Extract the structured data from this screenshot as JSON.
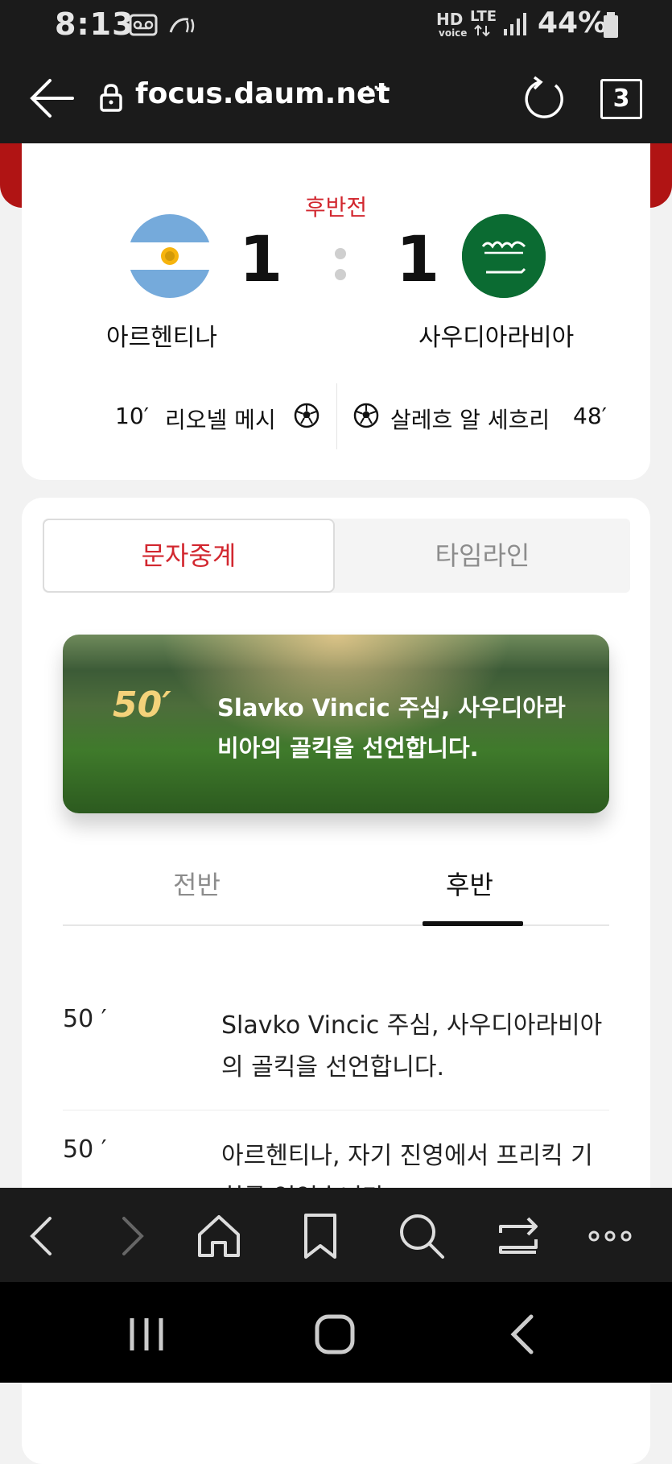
{
  "status_bar": {
    "time": "8:13",
    "network_hd": "HD",
    "network_voice": "voice",
    "network_lte": "LTE",
    "battery": "44%",
    "icons": [
      "voicemail-icon",
      "nfc-icon",
      "signal-icon",
      "battery-icon"
    ]
  },
  "browser": {
    "url": "focus.daum.net",
    "url_more": "···",
    "tab_count": "3",
    "icons": [
      "back-arrow-icon",
      "lock-icon",
      "reload-icon"
    ]
  },
  "match": {
    "period": "후반전",
    "home_team": "아르헨티나",
    "away_team": "사우디아라비아",
    "home_score": "1",
    "away_score": "1",
    "home_goal_minute": "10′",
    "home_goal_scorer": "리오넬 메시",
    "away_goal_scorer": "살레흐 알 세흐리",
    "away_goal_minute": "48′",
    "colors": {
      "accent": "#d2272f",
      "ksa_green": "#0b6b32",
      "arg_blue": "#75aadb"
    }
  },
  "tabs": {
    "active": "문자중계",
    "inactive": "타임라인"
  },
  "banner": {
    "minute": "50′",
    "text": "Slavko Vincic 주심, 사우디아라비아의 골킥을 선언합니다."
  },
  "half_tabs": {
    "first": "전반",
    "second": "후반",
    "selected": "second"
  },
  "feed": [
    {
      "minute": "50 ′",
      "text": "Slavko Vincic 주심, 사우디아라비아의 골킥을 선언합니다."
    },
    {
      "minute": "50 ′",
      "text": "아르헨티나, 자기 진영에서 프리킥 기회를 얻었습니다."
    }
  ],
  "toolbar": {
    "icons": [
      "back-icon",
      "forward-icon",
      "home-icon",
      "bookmark-icon",
      "search-icon",
      "tabs-switch-icon",
      "more-icon"
    ]
  },
  "system_nav": {
    "icons": [
      "recent-apps-icon",
      "home-nav-icon",
      "back-nav-icon"
    ]
  }
}
